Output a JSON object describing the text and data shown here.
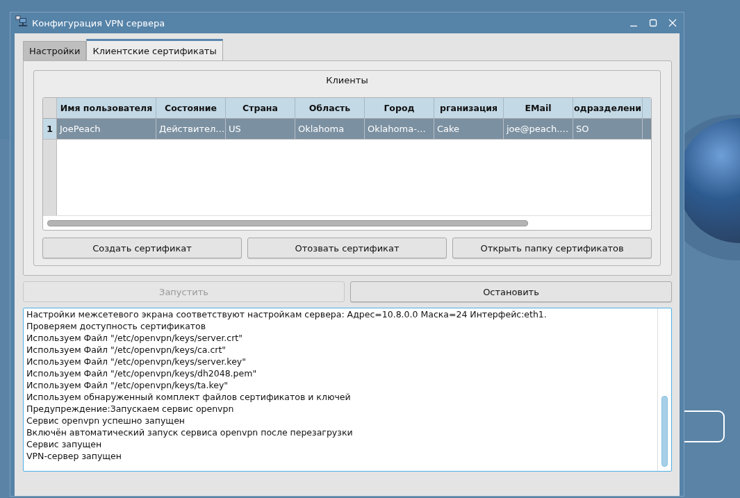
{
  "window": {
    "title": "Конфигурация VPN сервера"
  },
  "tabs": [
    {
      "label": "Настройки",
      "selected": false
    },
    {
      "label": "Клиентские сертификаты",
      "selected": true
    }
  ],
  "clients": {
    "title": "Клиенты",
    "table": {
      "columns": [
        "Имя пользователя",
        "Состояние",
        "Страна",
        "Область",
        "Город",
        "рганизация",
        "EMail",
        "одразделени"
      ],
      "rows": [
        {
          "number": "1",
          "selected": true,
          "cells": [
            "JoePeach",
            "Действител…",
            "US",
            "Oklahoma",
            "Oklahoma-…",
            "Cake",
            "joe@peach.…",
            "SO"
          ]
        }
      ]
    },
    "buttons": [
      "Создать сертификат",
      "Отозвать сертификат",
      "Открыть папку сертификатов"
    ]
  },
  "server_buttons": [
    {
      "label": "Запустить",
      "disabled": true
    },
    {
      "label": "Остановить",
      "disabled": false
    }
  ],
  "log": [
    "Настройки межсетевого экрана соответствуют настройкам сервера: Адрес=10.8.0.0 Маска=24 Интерфейс:eth1.",
    "Проверяем доступность сертификатов",
    "Используем Файл \"/etc/openvpn/keys/server.crt\"",
    "Используем Файл \"/etc/openvpn/keys/ca.crt\"",
    "Используем Файл \"/etc/openvpn/keys/server.key\"",
    "Используем Файл \"/etc/openvpn/keys/dh2048.pem\"",
    "Используем Файл \"/etc/openvpn/keys/ta.key\"",
    "Используем обнаруженный комплект файлов сертификатов и ключей",
    "Предупреждение:Запускаем сервис openvpn",
    "Сервис openvpn успешно запущен",
    "Включён автоматический запуск сервиса openvpn после перезагрузки",
    "Сервис запущен",
    "VPN-сервер запущен"
  ]
}
